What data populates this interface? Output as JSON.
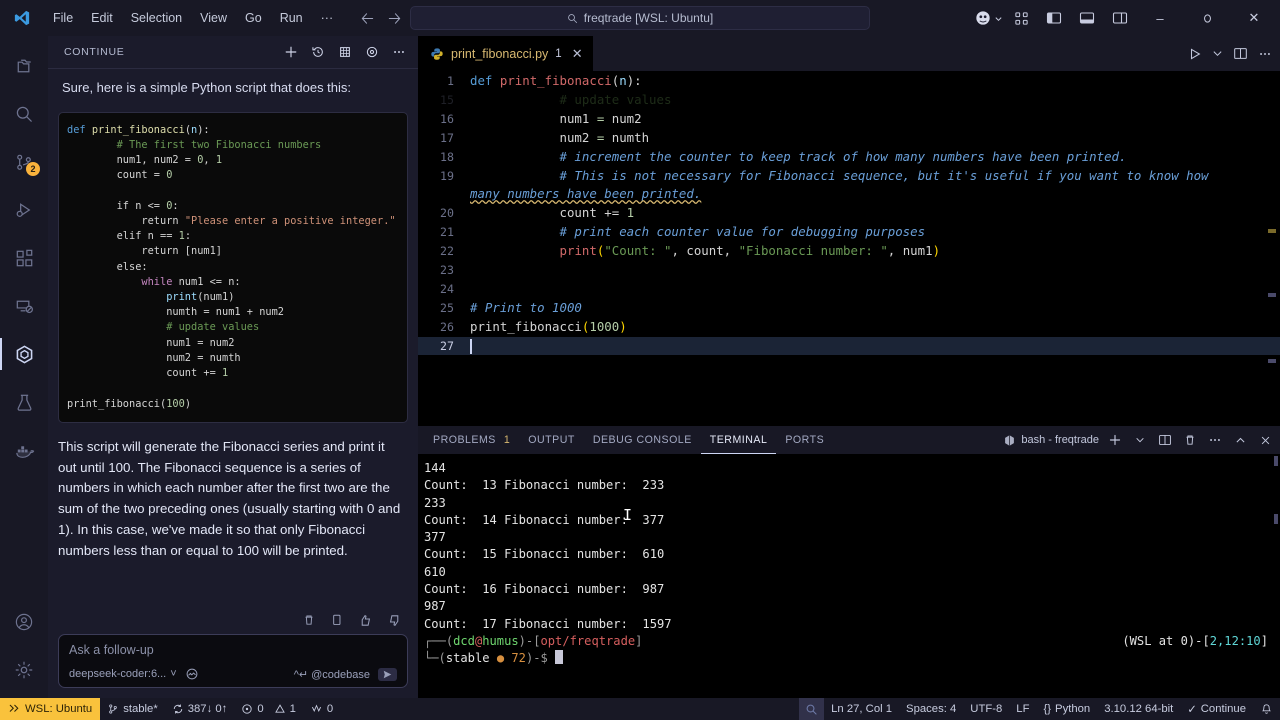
{
  "titlebar": {
    "menus": [
      "File",
      "Edit",
      "Selection",
      "View",
      "Go",
      "Run",
      "···"
    ],
    "search_text": "freqtrade [WSL: Ubuntu]",
    "back_icon": "arrow-left-icon",
    "forward_icon": "arrow-right-icon",
    "accounts_icon": "accounts-icon",
    "layout_icons": [
      "customize-layout-icon",
      "toggle-primary-sidebar-icon",
      "toggle-panel-icon",
      "toggle-secondary-sidebar-icon"
    ],
    "window_minimize": "–",
    "window_restore": "▭",
    "window_close": "✕"
  },
  "activitybar": {
    "items": [
      {
        "name": "explorer",
        "icon": "files-icon",
        "badge": ""
      },
      {
        "name": "search",
        "icon": "search-icon",
        "badge": ""
      },
      {
        "name": "source-control",
        "icon": "source-control-icon",
        "badge": "2"
      },
      {
        "name": "run-and-debug",
        "icon": "run-debug-icon",
        "badge": ""
      },
      {
        "name": "extensions",
        "icon": "extensions-icon",
        "badge": ""
      },
      {
        "name": "remote-explorer",
        "icon": "remote-explorer-icon",
        "badge": ""
      },
      {
        "name": "continue",
        "icon": "continue-icon",
        "badge": ""
      },
      {
        "name": "testing",
        "icon": "beaker-icon",
        "badge": ""
      },
      {
        "name": "docker",
        "icon": "docker-icon",
        "badge": ""
      }
    ],
    "bottom": [
      {
        "name": "accounts",
        "icon": "account-icon"
      },
      {
        "name": "settings",
        "icon": "gear-icon"
      }
    ]
  },
  "sidebar": {
    "title": "Continue",
    "actions": [
      "new-session-icon",
      "history-icon",
      "selection-icon",
      "target-icon",
      "more-actions-icon"
    ],
    "message": "Sure, here is a simple Python script that does this:",
    "code_lines": [
      "def print_fibonacci(n):",
      "    # The first two Fibonacci numbers",
      "    num1, num2 = 0, 1",
      "    count = 0",
      "",
      "    if n <= 0:",
      "        return \"Please enter a positive integer.\"",
      "    elif n == 1:",
      "        return [num1]",
      "    else:",
      "        while num1 <= n:",
      "            print(num1)",
      "            numth = num1 + num2",
      "            # update values",
      "            num1 = num2",
      "            num2 = numth",
      "            count += 1",
      "",
      "print_fibonacci(100)"
    ],
    "paragraph": "This script will generate the Fibonacci series and print it out until 100. The Fibonacci sequence is a series of numbers in which each number after the first two are the sum of the two preceding ones (usually starting with 0 and 1). In this case, we've made it so that only Fibonacci numbers less than or equal to 100 will be printed.",
    "feedback_icons": [
      "delete-icon",
      "copy-icon",
      "thumbs-up-icon",
      "thumbs-down-icon"
    ],
    "input_placeholder": "Ask a follow-up",
    "model_name": "deepseek-coder:6...",
    "model_chevron": "˅",
    "image_icon": "image-attach-icon",
    "codebase_hint": "^↵ @codebase",
    "send_icon": "send-icon"
  },
  "editor": {
    "tab": {
      "filename": "print_fibonacci.py",
      "dirty_count": "1",
      "close": "✕",
      "icon": "python-file-icon"
    },
    "tab_actions": [
      "run-python-file-icon",
      "chevron-down-icon",
      "split-editor-icon",
      "more-actions-icon"
    ],
    "sticky_line": {
      "number": "1",
      "text": "def print_fibonacci(n):"
    },
    "lines": [
      {
        "num": "15",
        "text": "            # update values",
        "partial": true
      },
      {
        "num": "16",
        "text": "            num1 = num2"
      },
      {
        "num": "17",
        "text": "            num2 = numth"
      },
      {
        "num": "18",
        "text": "            # increment the counter to keep track of how many numbers have been printed."
      },
      {
        "num": "19",
        "text": "            # This is not necessary for Fibonacci sequence, but it's useful if you want to know how many numbers have been printed."
      },
      {
        "num": "20",
        "text": "            count += 1"
      },
      {
        "num": "21",
        "text": "            # print each counter value for debugging purposes"
      },
      {
        "num": "22",
        "text": "            print(\"Count: \", count, \"Fibonacci number: \", num1)"
      },
      {
        "num": "23",
        "text": ""
      },
      {
        "num": "24",
        "text": ""
      },
      {
        "num": "25",
        "text": "# Print to 1000"
      },
      {
        "num": "26",
        "text": "print_fibonacci(1000)"
      },
      {
        "num": "27",
        "text": ""
      }
    ]
  },
  "panel": {
    "tabs": [
      {
        "label": "Problems",
        "count": "1",
        "active": false
      },
      {
        "label": "Output",
        "count": "",
        "active": false
      },
      {
        "label": "Debug Console",
        "count": "",
        "active": false
      },
      {
        "label": "Terminal",
        "count": "",
        "active": true
      },
      {
        "label": "Ports",
        "count": "",
        "active": false
      }
    ],
    "shell_name": "bash - freqtrade",
    "shell_icon": "terminal-bash-icon",
    "actions": [
      "new-terminal-icon",
      "chevron-down-icon",
      "split-terminal-icon",
      "kill-terminal-icon",
      "more-actions-icon",
      "maximize-panel-icon",
      "close-panel-icon"
    ],
    "terminal_lines": [
      {
        "type": "plain",
        "text": "144"
      },
      {
        "type": "plain",
        "text": "Count:  13 Fibonacci number:  233"
      },
      {
        "type": "plain",
        "text": "233"
      },
      {
        "type": "plain",
        "text": "Count:  14 Fibonacci number:  377"
      },
      {
        "type": "plain",
        "text": "377"
      },
      {
        "type": "plain",
        "text": "Count:  15 Fibonacci number:  610"
      },
      {
        "type": "plain",
        "text": "610"
      },
      {
        "type": "plain",
        "text": "Count:  16 Fibonacci number:  987"
      },
      {
        "type": "plain",
        "text": "987"
      },
      {
        "type": "plain",
        "text": "Count:  17 Fibonacci number:  1597"
      }
    ],
    "prompt": {
      "line1_user": "dcd",
      "line1_at": "@",
      "line1_host": "humus",
      "line1_path": "opt/freqtrade",
      "line2_branch": "stable",
      "line2_count": "72",
      "right_info": "(WSL at 0)-[",
      "right_pos": "2,12:10",
      "right_close": "]"
    }
  },
  "statusbar": {
    "remote_label": "WSL: Ubuntu",
    "remote_icon": "remote-indicator-icon",
    "branch": "stable*",
    "sync": "387↓ 0↑",
    "errors": "0",
    "warnings": "1",
    "ports": "0",
    "position": "Ln 27, Col 1",
    "indentation": "Spaces: 4",
    "encoding": "UTF-8",
    "eol": "LF",
    "language": "Python",
    "interpreter": "3.10.12 64-bit",
    "continue_status": "Continue",
    "bell_icon": "bell-icon",
    "search_icon": "search-status-icon"
  }
}
